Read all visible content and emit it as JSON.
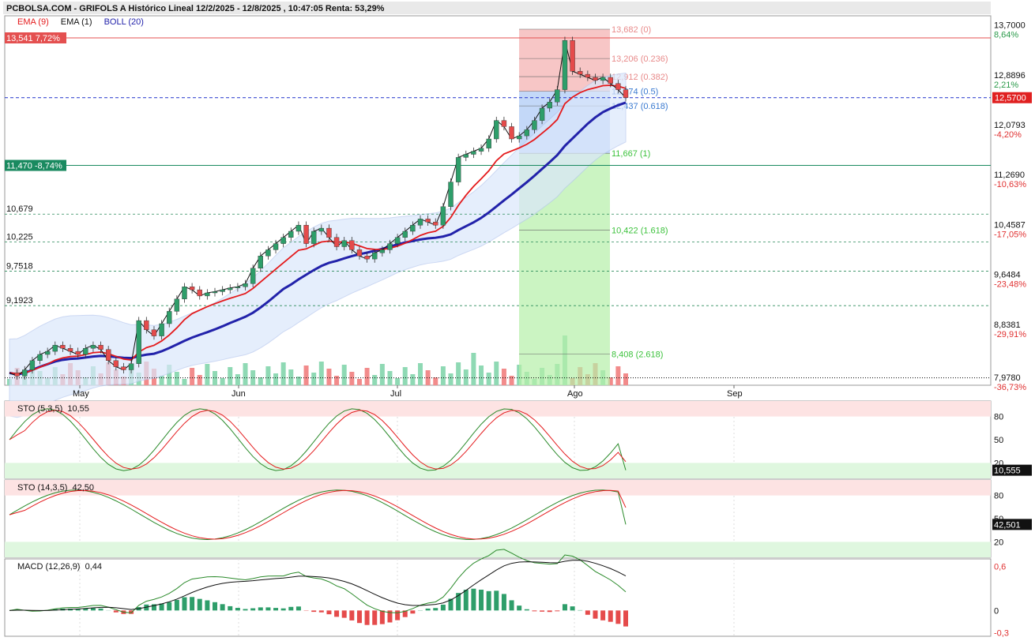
{
  "header": {
    "title": "PCBOLSA.COM - GRIFOLS A Histórico Lineal 12/2/2025 - 12/8/2025 , 10:47:05 Renta: 53,29%"
  },
  "legend": {
    "ema9": {
      "label": "EMA (9)",
      "color": "#e41a1c"
    },
    "ema1": {
      "label": "EMA (1)",
      "color": "#111111"
    },
    "boll": {
      "label": "BOLL (20)",
      "color": "#2222aa"
    }
  },
  "indicators": {
    "sto1": {
      "label": "STO (5,3,5)",
      "value": "10,55",
      "last_badge": "10,555"
    },
    "sto2": {
      "label": "STO (14,3,5)",
      "value": "42,50",
      "last_badge": "42,501"
    },
    "macd": {
      "label": "MACD (12,26,9)",
      "value": "0,44"
    }
  },
  "chart_data": {
    "type": "candlestick",
    "months": [
      "May",
      "Jun",
      "Jul",
      "Ago",
      "Sep"
    ],
    "price_axis": {
      "ticks": [
        "13,7000",
        "12,8896",
        "12,0793",
        "11,2690",
        "10,4587",
        "9,6484",
        "8,8381",
        "7,9780"
      ],
      "percent_ticks": [
        "8,64%",
        "2,21%",
        "-4,20%",
        "-10,63%",
        "-17,05%",
        "-23,48%",
        "-29,91%",
        "-36,73%"
      ],
      "ylim": [
        7.9,
        13.9
      ]
    },
    "last_price_badge": "12,5700",
    "left_levels": [
      {
        "label": "13,541  7,72%",
        "value": 13.541,
        "boxed": true,
        "color": "#e45050"
      },
      {
        "label": "11,470  -8,74%",
        "value": 11.47,
        "boxed": true,
        "color": "#1a8a60"
      },
      {
        "label": "10,679",
        "value": 10.679,
        "boxed": false
      },
      {
        "label": "10,225",
        "value": 10.225,
        "boxed": false
      },
      {
        "label": "9,7518",
        "value": 9.7518,
        "boxed": false
      },
      {
        "label": "9,1923",
        "value": 9.1923,
        "boxed": false
      }
    ],
    "fibonacci": [
      {
        "label": "13,682 (0)",
        "value": 13.682,
        "color": "#e88a8a"
      },
      {
        "label": "13,206 (0.236)",
        "value": 13.206,
        "color": "#e88a8a"
      },
      {
        "label": "12,912 (0.382)",
        "value": 12.912,
        "color": "#e88a8a"
      },
      {
        "label": "12,674 (0.5)",
        "value": 12.674,
        "color": "#3a7ad0"
      },
      {
        "label": "12,437 (0.618)",
        "value": 12.437,
        "color": "#3a7ad0"
      },
      {
        "label": "11,667 (1)",
        "value": 11.667,
        "color": "#3cc23c"
      },
      {
        "label": "10,422 (1.618)",
        "value": 10.422,
        "color": "#3cc23c"
      },
      {
        "label": "8,408 (2.618)",
        "value": 8.408,
        "color": "#3cc23c"
      }
    ],
    "osc_axis": [
      "80",
      "50",
      "20"
    ],
    "macd_axis": [
      "0,6",
      "0",
      "-0,3"
    ],
    "closes": [
      8.1,
      8.05,
      8.15,
      8.3,
      8.4,
      8.45,
      8.55,
      8.5,
      8.45,
      8.4,
      8.5,
      8.55,
      8.48,
      8.3,
      8.2,
      8.15,
      8.25,
      8.95,
      8.8,
      8.7,
      8.9,
      9.1,
      9.3,
      9.5,
      9.45,
      9.35,
      9.4,
      9.42,
      9.45,
      9.48,
      9.5,
      9.55,
      9.8,
      10.0,
      10.1,
      10.2,
      10.3,
      10.4,
      10.5,
      10.2,
      10.4,
      10.45,
      10.3,
      10.15,
      10.25,
      10.1,
      10.0,
      9.95,
      10.05,
      10.1,
      10.2,
      10.3,
      10.4,
      10.5,
      10.6,
      10.55,
      10.5,
      10.8,
      11.2,
      11.6,
      11.65,
      11.7,
      11.75,
      11.9,
      12.2,
      12.1,
      11.9,
      11.95,
      12.05,
      12.2,
      12.4,
      12.5,
      12.7,
      13.5,
      13.0,
      12.95,
      12.9,
      12.85,
      12.9,
      12.8,
      12.7,
      12.57
    ]
  }
}
